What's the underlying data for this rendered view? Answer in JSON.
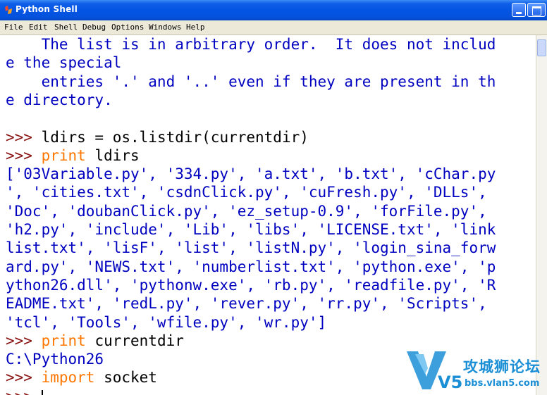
{
  "window": {
    "title": "Python Shell"
  },
  "menu": [
    "File",
    "Edit",
    "Shell",
    "Debug",
    "Options",
    "Windows",
    "Help"
  ],
  "shell": {
    "lines": [
      [
        {
          "t": "    The list is in arbitrary order.  It does not includ",
          "c": "out"
        }
      ],
      [
        {
          "t": "e the special",
          "c": "out"
        }
      ],
      [
        {
          "t": "    entries '.' and '..' even if they are present in th",
          "c": "out"
        }
      ],
      [
        {
          "t": "e directory.",
          "c": "out"
        }
      ],
      [
        {
          "t": "",
          "c": "out"
        }
      ],
      [
        {
          "t": ">>> ",
          "c": "prm"
        },
        {
          "t": "ldirs = os.listdir(currentdir)",
          "c": "cd"
        }
      ],
      [
        {
          "t": ">>> ",
          "c": "prm"
        },
        {
          "t": "print",
          "c": "kw"
        },
        {
          "t": " ldirs",
          "c": "cd"
        }
      ],
      [
        {
          "t": "['03Variable.py', '334.py', 'a.txt', 'b.txt', 'cChar.py",
          "c": "out"
        }
      ],
      [
        {
          "t": "', 'cities.txt', 'csdnClick.py', 'cuFresh.py', 'DLLs',",
          "c": "out"
        }
      ],
      [
        {
          "t": "'Doc', 'doubanClick.py', 'ez_setup-0.9', 'forFile.py',",
          "c": "out"
        }
      ],
      [
        {
          "t": "'h2.py', 'include', 'Lib', 'libs', 'LICENSE.txt', 'link",
          "c": "out"
        }
      ],
      [
        {
          "t": "list.txt', 'lisF', 'list', 'listN.py', 'login_sina_forw",
          "c": "out"
        }
      ],
      [
        {
          "t": "ard.py', 'NEWS.txt', 'numberlist.txt', 'python.exe', 'p",
          "c": "out"
        }
      ],
      [
        {
          "t": "ython26.dll', 'pythonw.exe', 'rb.py', 'readfile.py', 'R",
          "c": "out"
        }
      ],
      [
        {
          "t": "EADME.txt', 'redL.py', 'rever.py', 'rr.py', 'Scripts',",
          "c": "out"
        }
      ],
      [
        {
          "t": "'tcl', 'Tools', 'wfile.py', 'wr.py']",
          "c": "out"
        }
      ],
      [
        {
          "t": ">>> ",
          "c": "prm"
        },
        {
          "t": "print",
          "c": "kw"
        },
        {
          "t": " currentdir",
          "c": "cd"
        }
      ],
      [
        {
          "t": "C:\\Python26",
          "c": "out"
        }
      ],
      [
        {
          "t": ">>> ",
          "c": "prm"
        },
        {
          "t": "import",
          "c": "kw"
        },
        {
          "t": " socket",
          "c": "cd"
        }
      ],
      [
        {
          "t": ">>> ",
          "c": "prm"
        }
      ]
    ]
  },
  "watermark": {
    "logo": "V5",
    "name": "攻城狮论坛",
    "url": "bbs.vlan5.com"
  },
  "colors": {
    "output": "#0000c0",
    "prompt": "#8a1414",
    "keyword": "#ff7700",
    "code": "#000000",
    "titlebar": "#0454e3"
  }
}
